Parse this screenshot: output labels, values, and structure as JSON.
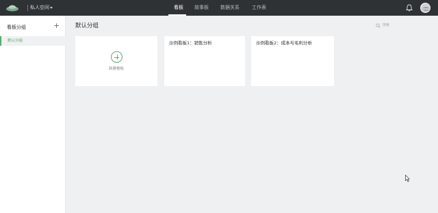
{
  "header": {
    "logo_icon": "leaf-logo-icon",
    "space_label": "私人空间",
    "tabs": [
      {
        "label": "看板",
        "active": true
      },
      {
        "label": "故事板",
        "active": false
      },
      {
        "label": "数据关系",
        "active": false
      },
      {
        "label": "工作表",
        "active": false
      }
    ],
    "bell_icon": "bell-icon",
    "avatar_icon": "user-avatar-icon"
  },
  "sidebar": {
    "title": "看板分组",
    "add_icon": "plus-icon",
    "groups": [
      {
        "label": "默认分组",
        "active": true
      }
    ]
  },
  "main": {
    "title": "默认分组",
    "search": {
      "placeholder": "搜索",
      "icon": "search-icon"
    },
    "new_card": {
      "label": "新建看板",
      "icon": "plus-circle-icon"
    },
    "cards": [
      {
        "title": "示例看板1：销售分析"
      },
      {
        "title": "示例看板2：成本与毛利分析"
      }
    ]
  },
  "colors": {
    "accent": "#5aa970",
    "topbar": "#2f3235",
    "background": "#eef0f2"
  }
}
